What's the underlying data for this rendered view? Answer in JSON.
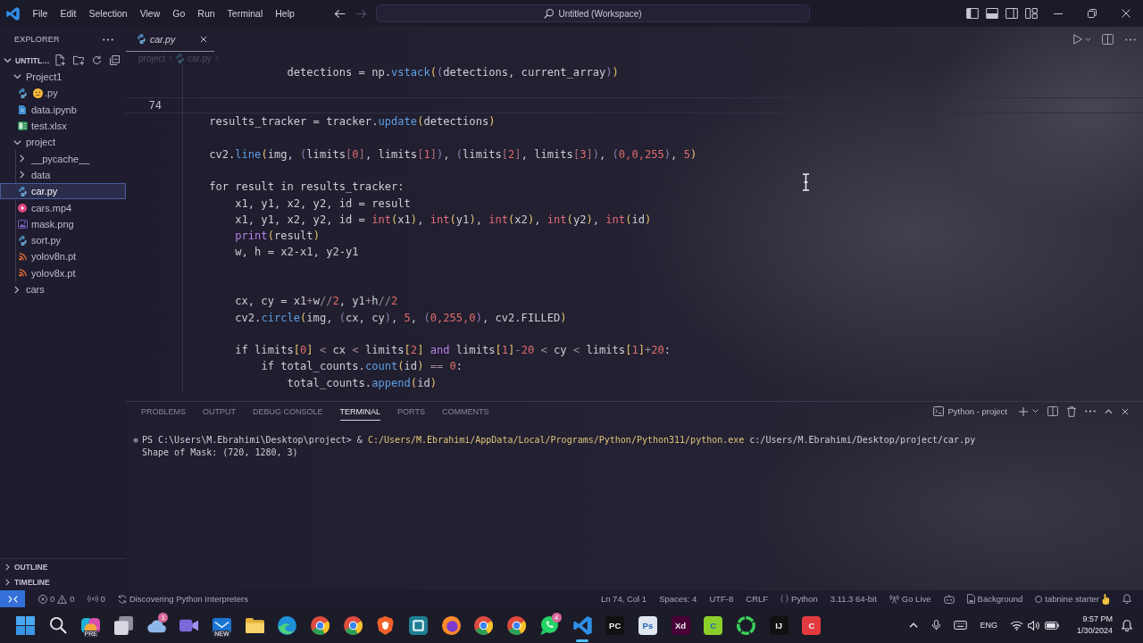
{
  "title_bar": {
    "menus": [
      "File",
      "Edit",
      "Selection",
      "View",
      "Go",
      "Run",
      "Terminal",
      "Help"
    ],
    "nav": [
      {
        "kind": "back",
        "disabled": false
      },
      {
        "kind": "forward",
        "disabled": true
      }
    ],
    "command_center": "Untitled (Workspace)"
  },
  "explorer": {
    "title": "EXPLORER",
    "workspace": {
      "label": "UNTITL…",
      "expanded": true
    },
    "tree": [
      {
        "label": "Project1",
        "kind": "folder",
        "expanded": true,
        "selected": false,
        "children": [
          {
            "label": ".py",
            "kind": "python",
            "emoji": true,
            "selected": false
          },
          {
            "label": "data.ipynb",
            "kind": "notebook",
            "emoji": false,
            "selected": false
          },
          {
            "label": "test.xlsx",
            "kind": "sheet",
            "emoji": false,
            "selected": false
          }
        ]
      },
      {
        "label": "project",
        "kind": "folder",
        "expanded": true,
        "selected": false,
        "children": [
          {
            "label": "__pycache__",
            "kind": "folder",
            "expanded": false,
            "selected": false
          },
          {
            "label": "data",
            "kind": "folder",
            "expanded": false,
            "selected": false
          },
          {
            "label": "car.py",
            "kind": "python",
            "emoji": false,
            "selected": true
          },
          {
            "label": "cars.mp4",
            "kind": "video",
            "emoji": false,
            "selected": false
          },
          {
            "label": "mask.png",
            "kind": "image",
            "emoji": false,
            "selected": false
          },
          {
            "label": "sort.py",
            "kind": "python",
            "emoji": false,
            "selected": false
          },
          {
            "label": "yolov8n.pt",
            "kind": "model",
            "emoji": false,
            "selected": false
          },
          {
            "label": "yolov8x.pt",
            "kind": "model",
            "emoji": false,
            "selected": false
          }
        ]
      },
      {
        "label": "cars",
        "kind": "folder",
        "expanded": false,
        "selected": false
      }
    ],
    "sections": [
      {
        "label": "OUTLINE",
        "expanded": false
      },
      {
        "label": "TIMELINE",
        "expanded": false
      }
    ]
  },
  "editor": {
    "tabs": [
      {
        "label": "car.py",
        "kind": "python",
        "selected": true,
        "preview": true
      }
    ],
    "breadcrumbs": [
      {
        "label": "project",
        "kind": "folder"
      },
      {
        "label": "car.py",
        "kind": "python"
      }
    ],
    "lines": [
      {
        "current": false,
        "tokens": [
          {
            "text": "                detections = np.",
            "kind": "plain"
          },
          {
            "text": "vstack",
            "kind": "method"
          },
          {
            "text": "(",
            "kind": "bracket"
          },
          {
            "text": "(",
            "kind": "bracket2"
          },
          {
            "text": "detections, current_array",
            "kind": "plain"
          },
          {
            "text": ")",
            "kind": "bracket2"
          },
          {
            "text": ")",
            "kind": "bracket"
          }
        ]
      },
      {
        "current": false
      },
      {
        "number": "74",
        "current": true
      },
      {
        "current": false,
        "tokens": [
          {
            "text": "    results_tracker = tracker.",
            "kind": "plain"
          },
          {
            "text": "update",
            "kind": "method"
          },
          {
            "text": "(",
            "kind": "bracket"
          },
          {
            "text": "detections",
            "kind": "plain"
          },
          {
            "text": ")",
            "kind": "bracket"
          }
        ]
      },
      {
        "current": false
      },
      {
        "current": false,
        "tokens": [
          {
            "text": "    cv2.",
            "kind": "plain"
          },
          {
            "text": "line",
            "kind": "method"
          },
          {
            "text": "(",
            "kind": "bracket"
          },
          {
            "text": "img, ",
            "kind": "plain"
          },
          {
            "text": "(",
            "kind": "bracket2"
          },
          {
            "text": "limits",
            "kind": "plain"
          },
          {
            "text": "[",
            "kind": "bracket3"
          },
          {
            "text": "0",
            "kind": "number"
          },
          {
            "text": "]",
            "kind": "bracket3"
          },
          {
            "text": ", limits",
            "kind": "plain"
          },
          {
            "text": "[",
            "kind": "bracket3"
          },
          {
            "text": "1",
            "kind": "number"
          },
          {
            "text": "]",
            "kind": "bracket3"
          },
          {
            "text": ")",
            "kind": "bracket2"
          },
          {
            "text": ", ",
            "kind": "plain"
          },
          {
            "text": "(",
            "kind": "bracket2"
          },
          {
            "text": "limits",
            "kind": "plain"
          },
          {
            "text": "[",
            "kind": "bracket3"
          },
          {
            "text": "2",
            "kind": "number"
          },
          {
            "text": "]",
            "kind": "bracket3"
          },
          {
            "text": ", limits",
            "kind": "plain"
          },
          {
            "text": "[",
            "kind": "bracket3"
          },
          {
            "text": "3",
            "kind": "number"
          },
          {
            "text": "]",
            "kind": "bracket3"
          },
          {
            "text": ")",
            "kind": "bracket2"
          },
          {
            "text": ", ",
            "kind": "plain"
          },
          {
            "text": "(",
            "kind": "bracket2"
          },
          {
            "text": "0,0,255",
            "kind": "number"
          },
          {
            "text": ")",
            "kind": "bracket2"
          },
          {
            "text": ", ",
            "kind": "plain"
          },
          {
            "text": "5",
            "kind": "number"
          },
          {
            "text": ")",
            "kind": "bracket"
          }
        ]
      },
      {
        "current": false
      },
      {
        "current": false,
        "tokens": [
          {
            "text": "    for result in results_tracker:",
            "kind": "plain"
          }
        ]
      },
      {
        "current": false,
        "tokens": [
          {
            "text": "        x1, y1, x2, y2, id = result",
            "kind": "plain"
          }
        ]
      },
      {
        "current": false,
        "tokens": [
          {
            "text": "        x1, y1, x2, y2, id = ",
            "kind": "plain"
          },
          {
            "text": "int",
            "kind": "type"
          },
          {
            "text": "(",
            "kind": "bracket"
          },
          {
            "text": "x1",
            "kind": "plain"
          },
          {
            "text": ")",
            "kind": "bracket"
          },
          {
            "text": ", ",
            "kind": "plain"
          },
          {
            "text": "int",
            "kind": "type"
          },
          {
            "text": "(",
            "kind": "bracket"
          },
          {
            "text": "y1",
            "kind": "plain"
          },
          {
            "text": ")",
            "kind": "bracket"
          },
          {
            "text": ", ",
            "kind": "plain"
          },
          {
            "text": "int",
            "kind": "type"
          },
          {
            "text": "(",
            "kind": "bracket"
          },
          {
            "text": "x2",
            "kind": "plain"
          },
          {
            "text": ")",
            "kind": "bracket"
          },
          {
            "text": ", ",
            "kind": "plain"
          },
          {
            "text": "int",
            "kind": "type"
          },
          {
            "text": "(",
            "kind": "bracket"
          },
          {
            "text": "y2",
            "kind": "plain"
          },
          {
            "text": ")",
            "kind": "bracket"
          },
          {
            "text": ", ",
            "kind": "plain"
          },
          {
            "text": "int",
            "kind": "type"
          },
          {
            "text": "(",
            "kind": "bracket"
          },
          {
            "text": "id",
            "kind": "plain"
          },
          {
            "text": ")",
            "kind": "bracket"
          }
        ]
      },
      {
        "current": false,
        "tokens": [
          {
            "text": "        print",
            "kind": "keyword"
          },
          {
            "text": "(",
            "kind": "bracket"
          },
          {
            "text": "result",
            "kind": "plain"
          },
          {
            "text": ")",
            "kind": "bracket"
          }
        ]
      },
      {
        "current": false,
        "tokens": [
          {
            "text": "        w, h = x2-x1, y2-y1",
            "kind": "plain"
          }
        ]
      },
      {
        "current": false
      },
      {
        "current": false
      },
      {
        "current": false,
        "tokens": [
          {
            "text": "        cx, cy = x1",
            "kind": "plain"
          },
          {
            "text": "+",
            "kind": "operator"
          },
          {
            "text": "w",
            "kind": "plain"
          },
          {
            "text": "//",
            "kind": "operator"
          },
          {
            "text": "2",
            "kind": "number"
          },
          {
            "text": ", y1",
            "kind": "plain"
          },
          {
            "text": "+",
            "kind": "operator"
          },
          {
            "text": "h",
            "kind": "plain"
          },
          {
            "text": "//",
            "kind": "operator"
          },
          {
            "text": "2",
            "kind": "number"
          }
        ]
      },
      {
        "current": false,
        "tokens": [
          {
            "text": "        cv2.",
            "kind": "plain"
          },
          {
            "text": "circle",
            "kind": "method"
          },
          {
            "text": "(",
            "kind": "bracket"
          },
          {
            "text": "img, ",
            "kind": "plain"
          },
          {
            "text": "(",
            "kind": "bracket2"
          },
          {
            "text": "cx, cy",
            "kind": "plain"
          },
          {
            "text": ")",
            "kind": "bracket2"
          },
          {
            "text": ", ",
            "kind": "plain"
          },
          {
            "text": "5",
            "kind": "number"
          },
          {
            "text": ", ",
            "kind": "plain"
          },
          {
            "text": "(",
            "kind": "bracket2"
          },
          {
            "text": "0,255,0",
            "kind": "number"
          },
          {
            "text": ")",
            "kind": "bracket2"
          },
          {
            "text": ", cv2.FILLED",
            "kind": "plain"
          },
          {
            "text": ")",
            "kind": "bracket"
          }
        ]
      },
      {
        "current": false
      },
      {
        "current": false,
        "tokens": [
          {
            "text": "        if limits",
            "kind": "plain"
          },
          {
            "text": "[",
            "kind": "bracket"
          },
          {
            "text": "0",
            "kind": "number"
          },
          {
            "text": "]",
            "kind": "bracket"
          },
          {
            "text": " < ",
            "kind": "operator"
          },
          {
            "text": "cx",
            "kind": "plain"
          },
          {
            "text": " < ",
            "kind": "operator"
          },
          {
            "text": "limits",
            "kind": "plain"
          },
          {
            "text": "[",
            "kind": "bracket"
          },
          {
            "text": "2",
            "kind": "number"
          },
          {
            "text": "]",
            "kind": "bracket"
          },
          {
            "text": " and ",
            "kind": "keyword"
          },
          {
            "text": "limits",
            "kind": "plain"
          },
          {
            "text": "[",
            "kind": "bracket"
          },
          {
            "text": "1",
            "kind": "number"
          },
          {
            "text": "]",
            "kind": "bracket"
          },
          {
            "text": "-",
            "kind": "operator"
          },
          {
            "text": "20",
            "kind": "number"
          },
          {
            "text": " < ",
            "kind": "operator"
          },
          {
            "text": "cy",
            "kind": "plain"
          },
          {
            "text": " < ",
            "kind": "operator"
          },
          {
            "text": "limits",
            "kind": "plain"
          },
          {
            "text": "[",
            "kind": "bracket"
          },
          {
            "text": "1",
            "kind": "number"
          },
          {
            "text": "]",
            "kind": "bracket"
          },
          {
            "text": "+",
            "kind": "operator"
          },
          {
            "text": "20",
            "kind": "number"
          },
          {
            "text": ":",
            "kind": "plain"
          }
        ]
      },
      {
        "current": false,
        "tokens": [
          {
            "text": "            if total_counts.",
            "kind": "plain"
          },
          {
            "text": "count",
            "kind": "method"
          },
          {
            "text": "(",
            "kind": "bracket"
          },
          {
            "text": "id",
            "kind": "plain"
          },
          {
            "text": ")",
            "kind": "bracket"
          },
          {
            "text": " == ",
            "kind": "operator"
          },
          {
            "text": "0",
            "kind": "number"
          },
          {
            "text": ":",
            "kind": "plain"
          }
        ]
      },
      {
        "current": false,
        "tokens": [
          {
            "text": "                total_counts.",
            "kind": "plain"
          },
          {
            "text": "append",
            "kind": "method"
          },
          {
            "text": "(",
            "kind": "bracket"
          },
          {
            "text": "id",
            "kind": "plain"
          },
          {
            "text": ")",
            "kind": "bracket"
          }
        ]
      }
    ]
  },
  "panel": {
    "tabs": [
      {
        "label": "PROBLEMS",
        "selected": false
      },
      {
        "label": "OUTPUT",
        "selected": false
      },
      {
        "label": "DEBUG CONSOLE",
        "selected": false
      },
      {
        "label": "TERMINAL",
        "selected": true
      },
      {
        "label": "PORTS",
        "selected": false
      },
      {
        "label": "COMMENTS",
        "selected": false
      }
    ],
    "terminal_name": "Python - project",
    "terminal_lines": [
      {
        "decoration": true,
        "tokens": [
          {
            "text": "PS C:\\Users\\M.Ebrahimi\\Desktop\\project> & ",
            "kind": "plain"
          },
          {
            "text": "C:/Users/M.Ebrahimi/AppData/Local/Programs/Python/Python311/python.exe",
            "kind": "command"
          },
          {
            "text": " c:/Users/M.Ebrahimi/Desktop/project/car.py",
            "kind": "plain"
          }
        ]
      },
      {
        "decoration": false,
        "tokens": [
          {
            "text": "Shape of Mask: (720, 1280, 3)",
            "kind": "plain"
          }
        ]
      }
    ]
  },
  "status_bar": {
    "left": [
      {
        "kind": "problems",
        "errors": "0",
        "warnings": "0"
      },
      {
        "kind": "ports",
        "label": "0"
      },
      {
        "kind": "progress",
        "label": "Discovering Python Interpreters"
      }
    ],
    "right": [
      {
        "kind": "text",
        "label": "Ln 74, Col 1"
      },
      {
        "kind": "text",
        "label": "Spaces: 4"
      },
      {
        "kind": "text",
        "label": "UTF-8"
      },
      {
        "kind": "text",
        "label": "CRLF"
      },
      {
        "kind": "language",
        "label": "Python"
      },
      {
        "kind": "text",
        "label": "3.11.3 64-bit"
      },
      {
        "kind": "live",
        "label": "Go Live"
      },
      {
        "kind": "extension"
      },
      {
        "kind": "background",
        "label": "Background"
      },
      {
        "kind": "assistant",
        "label": "tabnine starter"
      },
      {
        "kind": "bell"
      }
    ]
  },
  "taskbar": {
    "apps": [
      {
        "kind": "start",
        "active": false
      },
      {
        "kind": "search",
        "active": false
      },
      {
        "kind": "blob",
        "tag": "PRE",
        "active": false
      },
      {
        "kind": "stack",
        "active": false
      },
      {
        "kind": "cloud",
        "badge": "1",
        "active": false
      },
      {
        "kind": "videocall",
        "active": false
      },
      {
        "kind": "mail",
        "tag": "NEW",
        "active": false
      },
      {
        "kind": "folder",
        "active": false
      },
      {
        "kind": "edge",
        "active": false
      },
      {
        "kind": "chrome",
        "active": false
      },
      {
        "kind": "chrome",
        "active": false
      },
      {
        "kind": "shield",
        "active": false
      },
      {
        "kind": "square",
        "active": false
      },
      {
        "kind": "firefox",
        "active": false
      },
      {
        "kind": "chrome",
        "active": false
      },
      {
        "kind": "chrome",
        "active": false
      },
      {
        "kind": "chat",
        "badge": "4",
        "active": false
      },
      {
        "kind": "editor",
        "active": true
      },
      {
        "kind": "tile",
        "label": "PC",
        "color": "#111111",
        "active": false
      },
      {
        "kind": "tile",
        "label": "Ps",
        "color": "#dfe6ef",
        "active": false
      },
      {
        "kind": "tile",
        "label": "Xd",
        "color": "#470137",
        "active": false
      },
      {
        "kind": "tile",
        "label": "C",
        "color": "#8ccf2b",
        "active": false
      },
      {
        "kind": "ring",
        "active": false
      },
      {
        "kind": "tile",
        "label": "IJ",
        "color": "#111111",
        "active": false
      },
      {
        "kind": "tile",
        "label": "C",
        "color": "#e23a3f",
        "active": false
      }
    ],
    "tray": {
      "language": "ENG",
      "time": "9:57 PM",
      "date": "1/30/2024"
    }
  }
}
